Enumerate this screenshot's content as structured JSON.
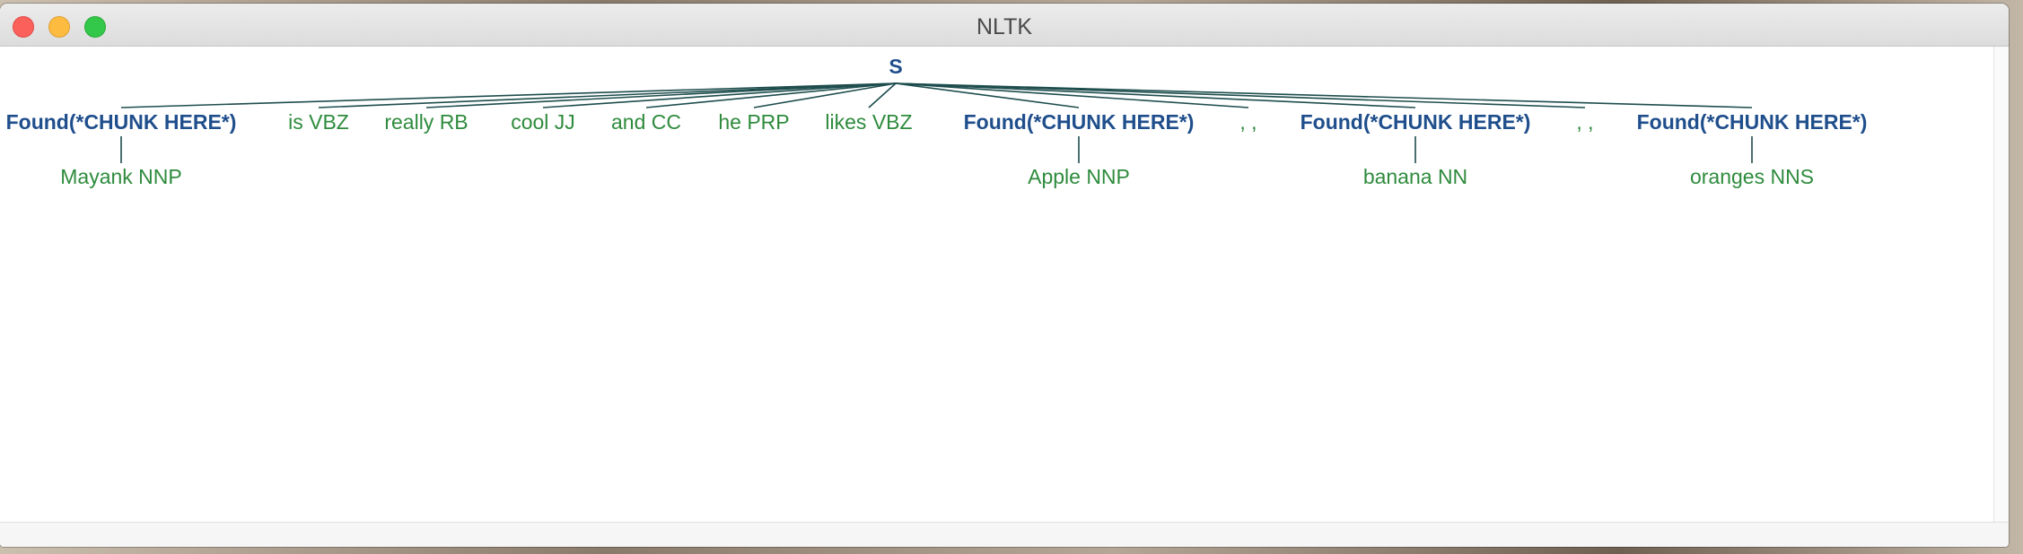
{
  "window": {
    "title": "NLTK"
  },
  "tree": {
    "root": "S",
    "children": [
      {
        "type": "chunk",
        "label": "Found(*CHUNK HERE*)",
        "leaf": "Mayank NNP"
      },
      {
        "type": "leaf",
        "label": "is VBZ"
      },
      {
        "type": "leaf",
        "label": "really RB"
      },
      {
        "type": "leaf",
        "label": "cool JJ"
      },
      {
        "type": "leaf",
        "label": "and CC"
      },
      {
        "type": "leaf",
        "label": "he PRP"
      },
      {
        "type": "leaf",
        "label": "likes VBZ"
      },
      {
        "type": "chunk",
        "label": "Found(*CHUNK HERE*)",
        "leaf": "Apple NNP"
      },
      {
        "type": "leaf",
        "label": ", ,"
      },
      {
        "type": "chunk",
        "label": "Found(*CHUNK HERE*)",
        "leaf": "banana NN"
      },
      {
        "type": "leaf",
        "label": ", ,"
      },
      {
        "type": "chunk",
        "label": "Found(*CHUNK HERE*)",
        "leaf": "oranges NNS"
      }
    ]
  },
  "colors": {
    "node": "#1f4e8c",
    "leaf": "#2e8b3d",
    "edge": "#1e4d4d"
  }
}
